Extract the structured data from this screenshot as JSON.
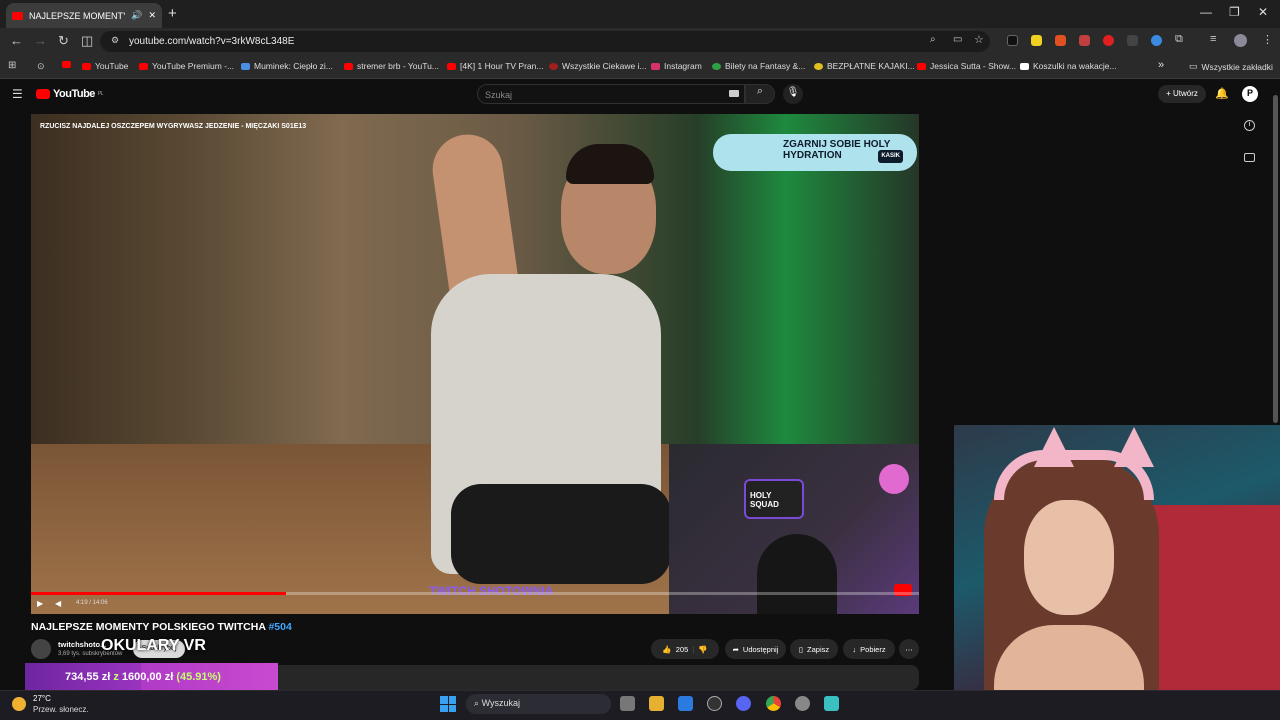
{
  "browser": {
    "tab_title": "NAJLEPSZE MOMENTY POL",
    "new_tab": "+",
    "url": "youtube.com/watch?v=3rkW8cL348E",
    "window_controls": [
      "—",
      "❐",
      "✕"
    ],
    "bookmarks": [
      {
        "label": "YouTube",
        "color": "#ff0000"
      },
      {
        "label": "YouTube Premium -...",
        "color": "#ff0000"
      },
      {
        "label": "Muminek: Ciepło zi...",
        "color": "#4a90e2"
      },
      {
        "label": "stremer brb - YouTu...",
        "color": "#ff0000"
      },
      {
        "label": "[4K] 1 Hour TV Pran...",
        "color": "#ff0000"
      },
      {
        "label": "Wszystkie Ciekawe i...",
        "color": "#a02020"
      },
      {
        "label": "Instagram",
        "color": "#d6336c"
      },
      {
        "label": "Bilety na Fantasy &...",
        "color": "#2ea043"
      },
      {
        "label": "BEZPŁATNE KAJAKI...",
        "color": "#e0c020"
      },
      {
        "label": "Jessica Sutta - Show...",
        "color": "#ff0000"
      },
      {
        "label": "Koszulki na wakacje...",
        "color": "#111111"
      }
    ],
    "all_bookmarks": "Wszystkie zakładki",
    "more_bookmarks": "»"
  },
  "youtube": {
    "logo_text": "YouTube",
    "logo_region": "PL",
    "search_placeholder": "Szukaj",
    "create_label": "+ Utwórz"
  },
  "video": {
    "overlay_title": "RZUCISZ NAJDALEJ OSZCZEPEM WYGRYWASZ JEDZENIE - MIĘCZAKI S01E13",
    "ad_text": "ZGARNIJ SOBIE HOLY HYDRATION",
    "ad_tag": "KASIK",
    "watermark": "TWITCH SHOTOWNIA",
    "pip_logo": "HOLY SQUAD",
    "time": "4:19 / 14:06",
    "progress": 0.287
  },
  "watch": {
    "title": "NAJLEPSZE MOMENTY POLSKIEGO TWITCHA",
    "hashtag": "#504",
    "channel": "twitchshoto...",
    "subs": "3,69 tys. subskrybentów",
    "subscribe": "Subskrybuj",
    "overlay_text": "OKULARY VR",
    "likes": "205",
    "share": "Udostępnij",
    "save": "Zapisz",
    "download": "Pobierz",
    "more": "⋯"
  },
  "goal": {
    "current": "734,55 zł",
    "sep": "z",
    "target": "1600,00 zł",
    "percent": "(45.91%)",
    "progress": 0.4591
  },
  "taskbar": {
    "temp": "27°C",
    "weather": "Przew. słonecz.",
    "search": "Wyszukaj"
  }
}
